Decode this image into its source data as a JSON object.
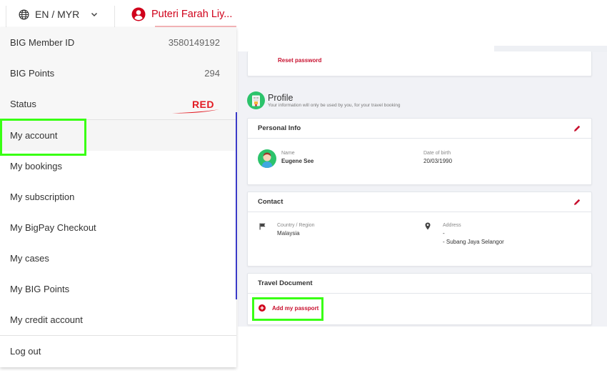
{
  "header": {
    "language_currency": "EN / MYR",
    "user_name": "Puteri Farah Liy...",
    "icons": {
      "language": "globe-icon",
      "user": "user-circle-icon",
      "dropdown": "chevron-down-icon"
    }
  },
  "account_dropdown": {
    "member_id_label": "BIG Member ID",
    "member_id_value": "3580149192",
    "points_label": "BIG Points",
    "points_value": "294",
    "status_label": "Status",
    "status_value": "RED",
    "menu_items": [
      {
        "label": "My account",
        "active": true
      },
      {
        "label": "My bookings"
      },
      {
        "label": "My subscription"
      },
      {
        "label": "My BigPay Checkout"
      },
      {
        "label": "My cases"
      },
      {
        "label": "My BIG Points"
      },
      {
        "label": "My credit account"
      }
    ],
    "logout_label": "Log out"
  },
  "main": {
    "reset_password_label": "Reset password",
    "profile": {
      "title": "Profile",
      "subtitle": "Your information will only be used by you, for your travel booking"
    },
    "personal_info": {
      "title": "Personal Info",
      "name_label": "Name",
      "name_value": "Eugene See",
      "dob_label": "Date of birth",
      "dob_value": "20/03/1990"
    },
    "contact": {
      "title": "Contact",
      "country_label": "Country / Region",
      "country_value": "Malaysia",
      "address_label": "Address",
      "address_line1": "-",
      "address_line2": "- Subang Jaya Selangor"
    },
    "travel_document": {
      "title": "Travel Document",
      "add_passport_label": "Add my passport"
    }
  },
  "colors": {
    "brand_red": "#d0021b",
    "status_red": "#e21b23",
    "profile_green": "#2cc36b",
    "highlight_green": "#39ff14"
  }
}
